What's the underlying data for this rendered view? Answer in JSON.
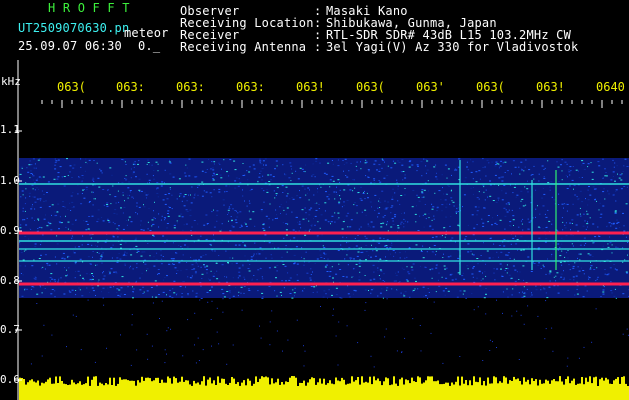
{
  "header": {
    "app_title": "H R O F F T",
    "filename": "UT2509070630.pn",
    "mode": "meteor",
    "datetime": "25.09.07 06:30",
    "counter": "0._",
    "fields": [
      {
        "label": "Observer",
        "value": "Masaki Kano"
      },
      {
        "label": "Receiving Location",
        "value": "Shibukawa, Gunma, Japan"
      },
      {
        "label": "Receiver",
        "value": "RTL-SDR SDR# 43dB L15 103.2MHz CW"
      },
      {
        "label": "Receiving Antenna",
        "value": "3el Yagi(V) Az 330 for Vladivostok"
      }
    ],
    "separator": ":"
  },
  "axis": {
    "unit": "kHz",
    "y_ticks": [
      "1.1",
      "1.0",
      "0.9",
      "0.8",
      "0.7",
      "0.6"
    ],
    "x_ticks": [
      "063(",
      "063:",
      "063:",
      "063:",
      "063!",
      "063(",
      "063'",
      "063(",
      "063!",
      "0640"
    ]
  },
  "colors": {
    "background": "#000000",
    "text": "#ffffff",
    "title": "#3cf03c",
    "filename": "#3df0f0",
    "time_ticks": "#f0f000",
    "spectrum_low": "#0a1a7a",
    "spectrum_mid": "#1e5cff",
    "spectrum_high": "#30e0e0",
    "spectrum_peak": "#ff2050",
    "signal_bar": "#f0f000"
  }
}
